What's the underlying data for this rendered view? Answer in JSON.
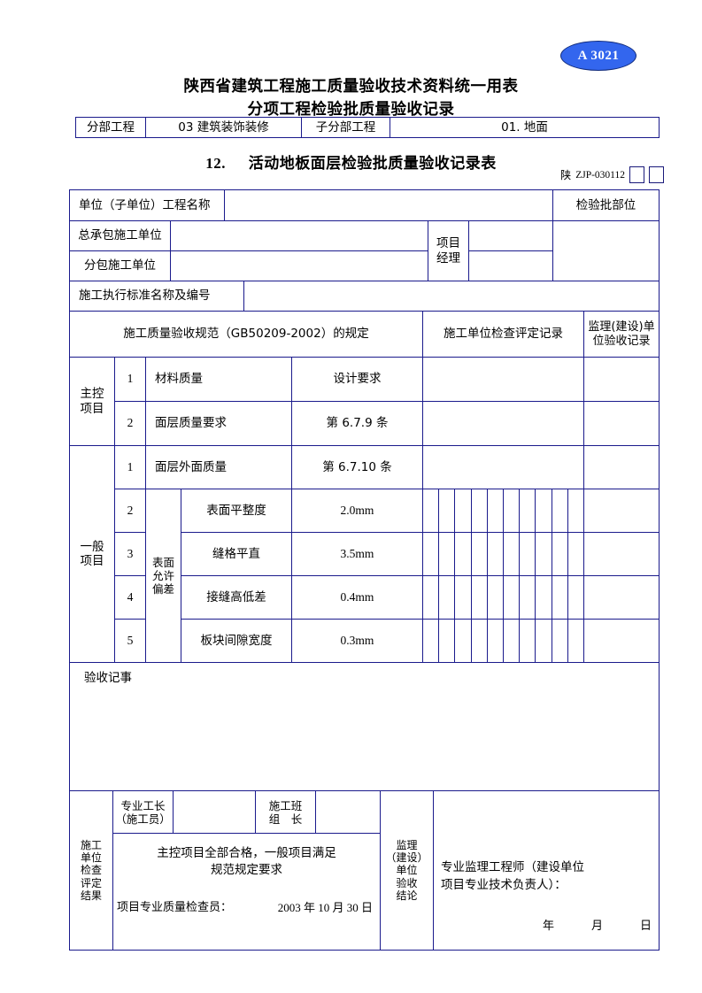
{
  "badge": {
    "label": "A 3021"
  },
  "titles": {
    "line1": "陕西省建筑工程施工质量验收技术资料统一用表",
    "line2": "分项工程检验批质量验收记录",
    "main_number": "12.",
    "main_text": "活动地板面层检验批质量验收记录表",
    "code_prefix": "陕",
    "code": "ZJP-030112"
  },
  "breadcrumb": {
    "part_label": "分部工程",
    "part_value": "03  建筑装饰装修",
    "subpart_label": "子分部工程",
    "subpart_value": "01.  地面"
  },
  "info": {
    "project_name_label": "单位（子单位）工程名称",
    "project_name_value": "",
    "batch_part_label": "检验批部位",
    "batch_part_value": "",
    "main_contractor_label": "总承包施工单位",
    "main_contractor_value": "",
    "sub_contractor_label": "分包施工单位",
    "sub_contractor_value": "",
    "project_manager_label": "项目\n经理",
    "project_manager_line1": "项目",
    "project_manager_line2": "经理",
    "manager_value_1": "",
    "manager_value_2": "",
    "standard_label": "施工执行标准名称及编号",
    "standard_value": ""
  },
  "table_header": {
    "spec": "施工质量验收规范（GB50209-2002）的规定",
    "contractor_record": "施工单位检查评定记录",
    "supervisor_record_line1": "监理(建设)单",
    "supervisor_record_line2": "位验收记录"
  },
  "sections": {
    "main_items": {
      "label_line1": "主控",
      "label_line2": "项目",
      "rows": [
        {
          "no": "1",
          "name": "材料质量",
          "requirement": "设计要求"
        },
        {
          "no": "2",
          "name": "面层质量要求",
          "requirement": "第 6.7.9 条"
        }
      ]
    },
    "general_items": {
      "label_line1": "一般",
      "label_line2": "项目",
      "deviation_label_lines": [
        "表面",
        "允许",
        "偏差"
      ],
      "rows": [
        {
          "no": "1",
          "name": "面层外面质量",
          "requirement": "第 6.7.10 条"
        },
        {
          "no": "2",
          "name": "表面平整度",
          "requirement": "2.0mm"
        },
        {
          "no": "3",
          "name": "缝格平直",
          "requirement": "3.5mm"
        },
        {
          "no": "4",
          "name": "接缝高低差",
          "requirement": "0.4mm"
        },
        {
          "no": "5",
          "name": "板块间隙宽度",
          "requirement": "0.3mm"
        }
      ],
      "tally_columns": 10
    }
  },
  "acceptance_notes": {
    "label": "验收记事",
    "value": ""
  },
  "footer": {
    "contractor_result_label_lines": [
      "施工",
      "单位",
      "检查",
      "评定",
      "结果"
    ],
    "foreman_label_line1": "专业工长",
    "foreman_label_line2": "（施工员）",
    "foreman_value": "",
    "team_leader_label_line1": "施工班",
    "team_leader_label_line2": "组　长",
    "team_leader_value": "",
    "conclusion_line1": "主控项目全部合格，一般项目满足",
    "conclusion_line2": "规范规定要求",
    "inspector_label": "项目专业质量检查员：",
    "inspector_date": "2003 年 10 月  30 日",
    "supervisor_label_lines": [
      "监理",
      "（建设）",
      "单位",
      "验收",
      "结论"
    ],
    "supervisor_sign_line1": "专业监理工程师（建设单位",
    "supervisor_sign_line2": "项目专业技术负责人）：",
    "supervisor_date_y": "年",
    "supervisor_date_m": "月",
    "supervisor_date_d": "日"
  },
  "colors": {
    "border": "#1a1a8c",
    "badge_fill": "#3366ee",
    "badge_text": "#ffffff"
  }
}
